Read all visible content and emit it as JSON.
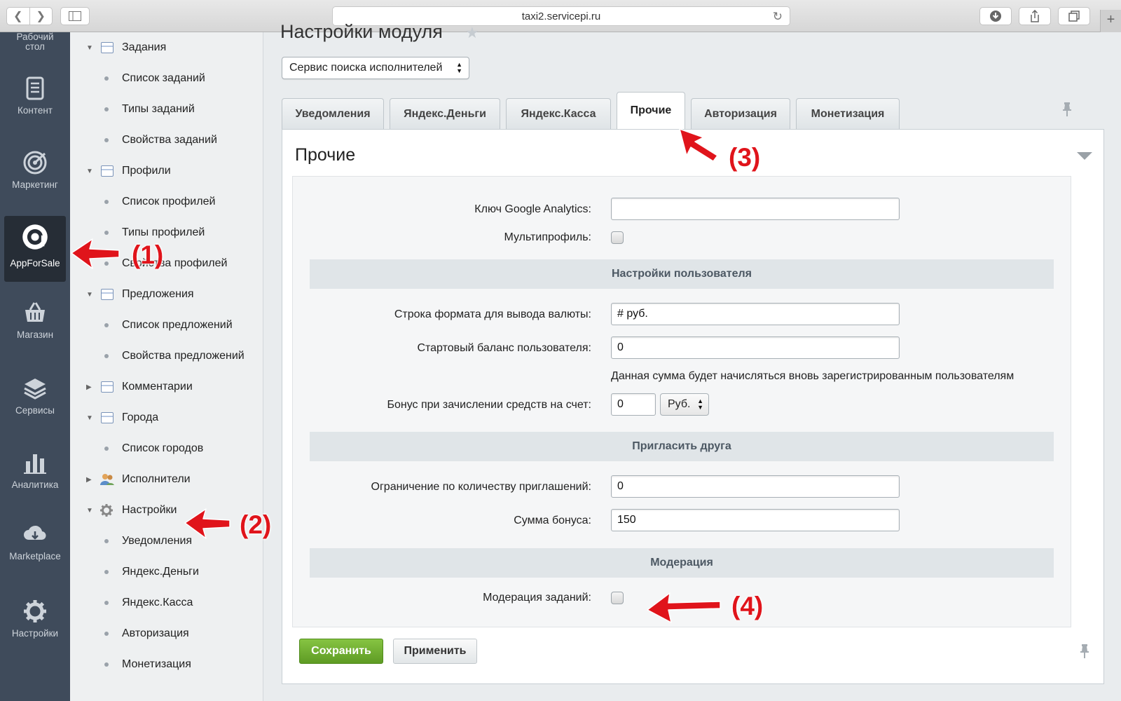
{
  "browser": {
    "url": "taxi2.servicepi.ru",
    "plus_label": "+"
  },
  "rail": {
    "items": [
      {
        "label": "Рабочий стол",
        "icon": "desktop-icon"
      },
      {
        "label": "Контент",
        "icon": "document-icon"
      },
      {
        "label": "Маркетинг",
        "icon": "target-icon"
      },
      {
        "label": "AppForSale",
        "icon": "appforsale-icon",
        "active": true
      },
      {
        "label": "Магазин",
        "icon": "basket-icon"
      },
      {
        "label": "Сервисы",
        "icon": "layers-icon"
      },
      {
        "label": "Аналитика",
        "icon": "bar-chart-icon"
      },
      {
        "label": "Marketplace",
        "icon": "cloud-download-icon"
      },
      {
        "label": "Настройки",
        "icon": "gear-icon"
      }
    ]
  },
  "tree": {
    "items": [
      {
        "label": "Задания",
        "type": "folder",
        "expanded": true
      },
      {
        "label": "Список заданий",
        "type": "leaf"
      },
      {
        "label": "Типы заданий",
        "type": "leaf"
      },
      {
        "label": "Свойства заданий",
        "type": "leaf"
      },
      {
        "label": "Профили",
        "type": "folder",
        "expanded": true
      },
      {
        "label": "Список профилей",
        "type": "leaf"
      },
      {
        "label": "Типы профилей",
        "type": "leaf"
      },
      {
        "label": "Свойства профилей",
        "type": "leaf"
      },
      {
        "label": "Предложения",
        "type": "folder",
        "expanded": true
      },
      {
        "label": "Список предложений",
        "type": "leaf"
      },
      {
        "label": "Свойства предложений",
        "type": "leaf"
      },
      {
        "label": "Комментарии",
        "type": "folder",
        "expanded": false
      },
      {
        "label": "Города",
        "type": "folder",
        "expanded": true
      },
      {
        "label": "Список городов",
        "type": "leaf"
      },
      {
        "label": "Исполнители",
        "type": "users",
        "expanded": false
      },
      {
        "label": "Настройки",
        "type": "gear",
        "expanded": true
      },
      {
        "label": "Уведомления",
        "type": "leaf"
      },
      {
        "label": "Яндекс.Деньги",
        "type": "leaf"
      },
      {
        "label": "Яндекс.Касса",
        "type": "leaf"
      },
      {
        "label": "Авторизация",
        "type": "leaf"
      },
      {
        "label": "Монетизация",
        "type": "leaf"
      }
    ]
  },
  "main": {
    "page_title": "Настройки модуля",
    "module_select": "Сервис поиска исполнителей",
    "tabs": [
      {
        "label": "Уведомления"
      },
      {
        "label": "Яндекс.Деньги"
      },
      {
        "label": "Яндекс.Касса"
      },
      {
        "label": "Прочие",
        "active": true
      },
      {
        "label": "Авторизация"
      },
      {
        "label": "Монетизация"
      }
    ],
    "panel_title": "Прочие",
    "fields": {
      "ga_label": "Ключ Google Analytics:",
      "ga_value": "",
      "multiprofile_label": "Мультипрофиль:",
      "multiprofile_checked": false,
      "section_user": "Настройки пользователя",
      "currency_format_label": "Строка формата для вывода валюты:",
      "currency_format_value": "# руб.",
      "start_balance_label": "Стартовый баланс пользователя:",
      "start_balance_value": "0",
      "start_balance_hint": "Данная сумма будет начисляться вновь зарегистрированным пользователям",
      "bonus_label": "Бонус при зачислении средств на счет:",
      "bonus_value": "0",
      "bonus_currency": "Руб.",
      "section_invite": "Пригласить друга",
      "invite_limit_label": "Ограничение по количеству приглашений:",
      "invite_limit_value": "0",
      "bonus_sum_label": "Сумма бонуса:",
      "bonus_sum_value": "150",
      "section_moderation": "Модерация",
      "moderation_label": "Модерация заданий:",
      "moderation_checked": false
    },
    "save_label": "Сохранить",
    "apply_label": "Применить"
  },
  "annotations": [
    "(1)",
    "(2)",
    "(3)",
    "(4)"
  ],
  "colors": {
    "accent_red": "#e0141b",
    "save_green": "#6aa82e",
    "rail_bg": "#3f4b5b"
  }
}
